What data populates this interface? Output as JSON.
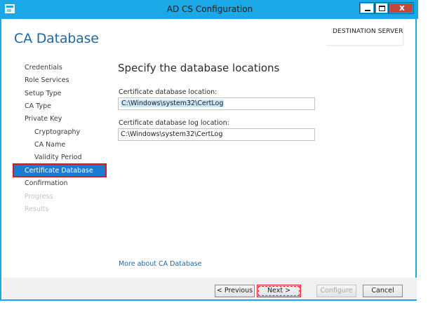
{
  "window": {
    "title": "AD CS Configuration",
    "close_glyph": "x"
  },
  "header": {
    "page_title": "CA Database",
    "destination_server_label": "DESTINATION SERVER"
  },
  "nav": {
    "items": [
      {
        "label": "Credentials",
        "state": "normal"
      },
      {
        "label": "Role Services",
        "state": "normal"
      },
      {
        "label": "Setup Type",
        "state": "normal"
      },
      {
        "label": "CA Type",
        "state": "normal"
      },
      {
        "label": "Private Key",
        "state": "normal"
      },
      {
        "label": "Cryptography",
        "state": "normal"
      },
      {
        "label": "CA Name",
        "state": "normal"
      },
      {
        "label": "Validity Period",
        "state": "normal"
      },
      {
        "label": "Certificate Database",
        "state": "selected"
      },
      {
        "label": "Confirmation",
        "state": "normal"
      },
      {
        "label": "Progress",
        "state": "disabled"
      },
      {
        "label": "Results",
        "state": "disabled"
      }
    ]
  },
  "main": {
    "section_title": "Specify the database locations",
    "db_location": {
      "label": "Certificate database location:",
      "value": "C:\\Windows\\system32\\CertLog"
    },
    "db_log_location": {
      "label": "Certificate database log location:",
      "value": "C:\\Windows\\system32\\CertLog"
    },
    "more_link": "More about CA Database"
  },
  "footer": {
    "previous_label": "< Previous",
    "next_label": "Next >",
    "configure_label": "Configure",
    "cancel_label": "Cancel"
  },
  "colors": {
    "title_bar": "#1aa9e6",
    "accent_blue": "#1e67a6",
    "selection_blue": "#1a7bd0",
    "highlight_red": "#d71920"
  }
}
